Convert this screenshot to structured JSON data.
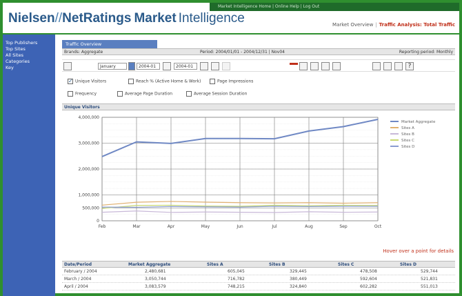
{
  "header": {
    "brand_nielsen": "Nielsen",
    "brand_slash": "//",
    "brand_net": "NetRatings",
    "brand_mi_bold": "Market",
    "brand_mi": "Intelligence",
    "topbar_text": "Market Intelligence Home  |  Online Help  |  Log Out",
    "link1": "Market Overview",
    "link2": "Traffic Analysis: Total Traffic"
  },
  "sidebar": {
    "items": [
      "Top Publishers",
      "Top Sites",
      "All Sites",
      "Categories",
      "Key"
    ]
  },
  "main": {
    "tab_label": "Traffic Overview",
    "bar_left": "Brands: Aggregate",
    "bar_mid": "Period: 2004/01/01 - 2004/12/31  |  Nov04",
    "bar_right": "Reporting period: Monthly",
    "toolbar": {
      "field1": "January",
      "field2": "2004-01",
      "field3": "2004-01"
    },
    "checks": [
      {
        "label": "Unique Visitors",
        "on": true
      },
      {
        "label": "Reach % (Active Home & Work)",
        "on": false
      },
      {
        "label": "Page Impressions",
        "on": false
      },
      {
        "label": "Frequency",
        "on": false
      },
      {
        "label": "Average Page Duration",
        "on": false
      },
      {
        "label": "Average Session Duration",
        "on": false
      }
    ],
    "section_title": "Unique Visitors",
    "note": "Hover over a point for details",
    "table": {
      "headers": [
        "Date/Period",
        "Market Aggregate",
        "Sites A",
        "Sites B",
        "Sites C",
        "Sites D"
      ],
      "rows": [
        [
          "February / 2004",
          "2,480,681",
          "605,045",
          "329,445",
          "478,508",
          "529,744"
        ],
        [
          "March / 2004",
          "3,050,744",
          "716,782",
          "380,449",
          "592,604",
          "521,831"
        ],
        [
          "April / 2004",
          "3,083,579",
          "748,215",
          "324,840",
          "602,282",
          "551,013"
        ]
      ]
    }
  },
  "chart_data": {
    "type": "line",
    "categories": [
      "Feb",
      "Mar",
      "Apr",
      "May",
      "Jun",
      "Jul",
      "Aug",
      "Sep",
      "Oct"
    ],
    "ylim": [
      0,
      4000000
    ],
    "yticks": [
      "4,000,000",
      "3,000,000",
      "2,000,000",
      "1,000,000",
      "500,000",
      "0"
    ],
    "yticks_values": [
      4000000,
      3000000,
      2000000,
      1000000,
      500000,
      0
    ],
    "series": [
      {
        "name": "Market Aggregate",
        "color": "#6f88c4",
        "values": [
          2480681,
          3050744,
          2990000,
          3180000,
          3180000,
          3170000,
          3470000,
          3640000,
          3920000
        ]
      },
      {
        "name": "Sites A",
        "color": "#e0b070",
        "values": [
          605045,
          716782,
          748215,
          720000,
          700000,
          690000,
          700000,
          680000,
          700000
        ]
      },
      {
        "name": "Sites B",
        "color": "#c8b8d8",
        "values": [
          329445,
          380449,
          324840,
          340000,
          330000,
          320000,
          350000,
          330000,
          340000
        ]
      },
      {
        "name": "Sites C",
        "color": "#c8d870",
        "values": [
          478508,
          592604,
          602282,
          570000,
          560000,
          600000,
          580000,
          600000,
          590000
        ]
      },
      {
        "name": "Sites D",
        "color": "#8a9cd0",
        "values": [
          529744,
          521831,
          551013,
          540000,
          530000,
          560000,
          550000,
          560000,
          560000
        ]
      }
    ]
  }
}
